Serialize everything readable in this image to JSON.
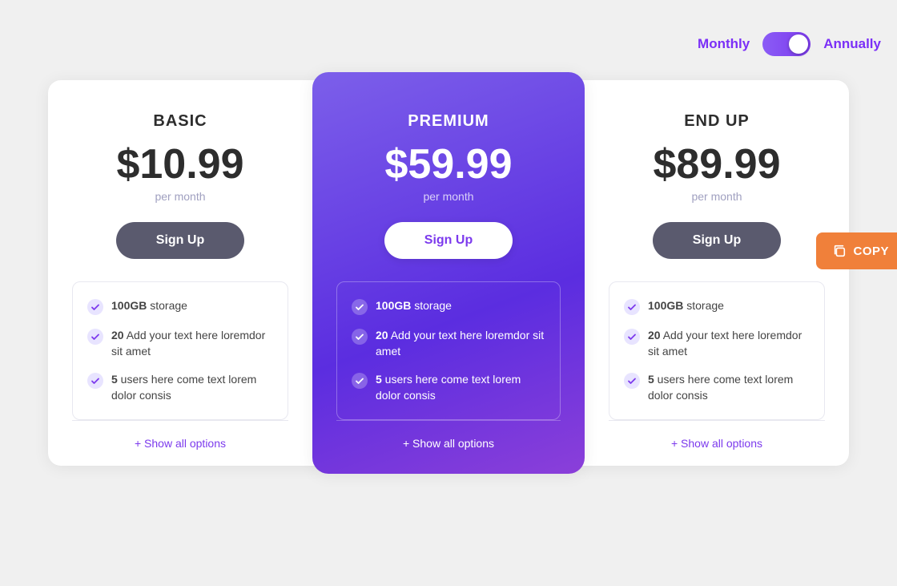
{
  "billing": {
    "monthly_label": "Monthly",
    "annually_label": "Annually",
    "toggle_state": "annually"
  },
  "plans": [
    {
      "id": "basic",
      "name": "BASIC",
      "price": "$10.99",
      "period": "per month",
      "signup_label": "Sign Up",
      "features": [
        {
          "bold": "100GB",
          "text": " storage"
        },
        {
          "bold": "20",
          "text": " Add your text here loremdor sit amet"
        },
        {
          "bold": "5",
          "text": " users here come text lorem dolor consis"
        }
      ],
      "show_options_label": "+ Show all options",
      "style": "basic"
    },
    {
      "id": "premium",
      "name": "PREMIUM",
      "price": "$59.99",
      "period": "per month",
      "signup_label": "Sign Up",
      "features": [
        {
          "bold": "100GB",
          "text": " storage"
        },
        {
          "bold": "20",
          "text": " Add your text here loremdor sit amet"
        },
        {
          "bold": "5",
          "text": " users here come text lorem dolor consis"
        }
      ],
      "show_options_label": "+ Show all options",
      "style": "premium"
    },
    {
      "id": "endup",
      "name": "END UP",
      "price": "$89.99",
      "period": "per month",
      "signup_label": "Sign Up",
      "features": [
        {
          "bold": "100GB",
          "text": " storage"
        },
        {
          "bold": "20",
          "text": " Add your text here loremdor sit amet"
        },
        {
          "bold": "5",
          "text": " users here come text lorem dolor consis"
        }
      ],
      "show_options_label": "+ Show all options",
      "style": "endup"
    }
  ],
  "copy_button": {
    "label": "COPY",
    "icon": "copy-icon"
  }
}
